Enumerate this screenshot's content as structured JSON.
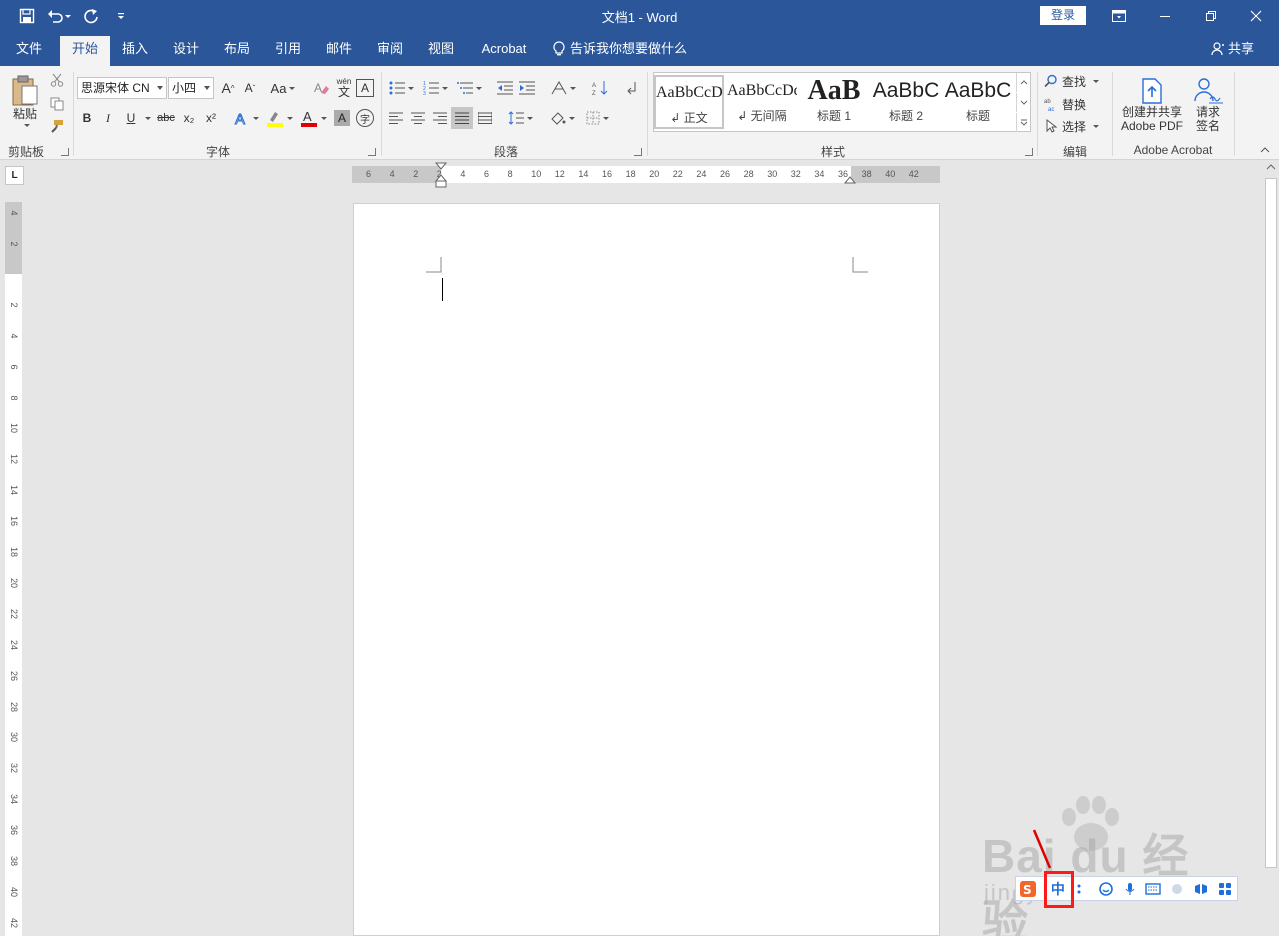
{
  "titlebar": {
    "doc_title": "文档1  -  Word",
    "login_label": "登录",
    "qat_icons": [
      "save-icon",
      "undo-icon",
      "redo-icon",
      "customize-qat-icon"
    ],
    "window_icons": [
      "ribbon-display-options-icon",
      "minimize-icon",
      "restore-icon",
      "close-icon"
    ]
  },
  "tabs": {
    "items": [
      "文件",
      "开始",
      "插入",
      "设计",
      "布局",
      "引用",
      "邮件",
      "审阅",
      "视图",
      "Acrobat"
    ],
    "active": "开始",
    "tell_me": "告诉我你想要做什么",
    "share": "共享"
  },
  "ribbon": {
    "clipboard": {
      "label": "剪贴板",
      "paste_label": "粘贴"
    },
    "font": {
      "label": "字体",
      "font_name": "思源宋体 CN",
      "font_size": "小四",
      "bold": "B",
      "italic": "I",
      "underline": "U",
      "strike": "abc",
      "subscript": "x₂",
      "superscript": "x²",
      "change_case": "Aa",
      "grow": "A",
      "shrink": "A",
      "phonetic": "wén",
      "phonetic_char": "文",
      "border_char": "A",
      "enclose_char": "字",
      "highlight_color": "#ffff00",
      "font_color": "#e00000"
    },
    "paragraph": {
      "label": "段落"
    },
    "styles": {
      "label": "样式",
      "items": [
        {
          "preview": "AaBbCcDd",
          "name": "↲ 正文"
        },
        {
          "preview": "AaBbCcDd",
          "name": "↲ 无间隔"
        },
        {
          "preview": "AaB",
          "name": "标题 1"
        },
        {
          "preview": "AaBbC",
          "name": "标题 2"
        },
        {
          "preview": "AaBbC",
          "name": "标题"
        }
      ]
    },
    "editing": {
      "label": "编辑",
      "find": "查找",
      "replace": "替换",
      "select": "选择"
    },
    "acrobat": {
      "label": "Adobe Acrobat",
      "create_share_line1": "创建并共享",
      "create_share_line2": "Adobe PDF",
      "request_line1": "请求",
      "request_line2": "签名"
    }
  },
  "rulers": {
    "corner": "L",
    "horizontal_ticks": [
      "6",
      "4",
      "2",
      "2",
      "4",
      "6",
      "8",
      "10",
      "12",
      "14",
      "16",
      "18",
      "20",
      "22",
      "24",
      "26",
      "28",
      "30",
      "32",
      "34",
      "36",
      "38",
      "40",
      "42"
    ],
    "vertical_ticks": [
      "4",
      "2",
      "2",
      "4",
      "6",
      "8",
      "10",
      "12",
      "14",
      "16",
      "18",
      "20",
      "22",
      "24",
      "26",
      "28",
      "30",
      "32",
      "34",
      "36",
      "38",
      "40",
      "42"
    ]
  },
  "ime": {
    "mode_char": "中",
    "icons": [
      "sogou-logo-icon",
      "chinese-mode-icon",
      "punctuation-icon",
      "emoji-icon",
      "voice-icon",
      "keyboard-icon",
      "skin-icon",
      "toolbox-icon",
      "menu-icon"
    ]
  },
  "watermark": {
    "main": "Bai du 经验",
    "sub": "jingyan.baidu.com"
  },
  "colors": {
    "brand": "#2b579a",
    "ribbon_bg": "#f3f3f3",
    "canvas_bg": "#e6e6e6",
    "highlight_box": "#ff1a1a"
  }
}
